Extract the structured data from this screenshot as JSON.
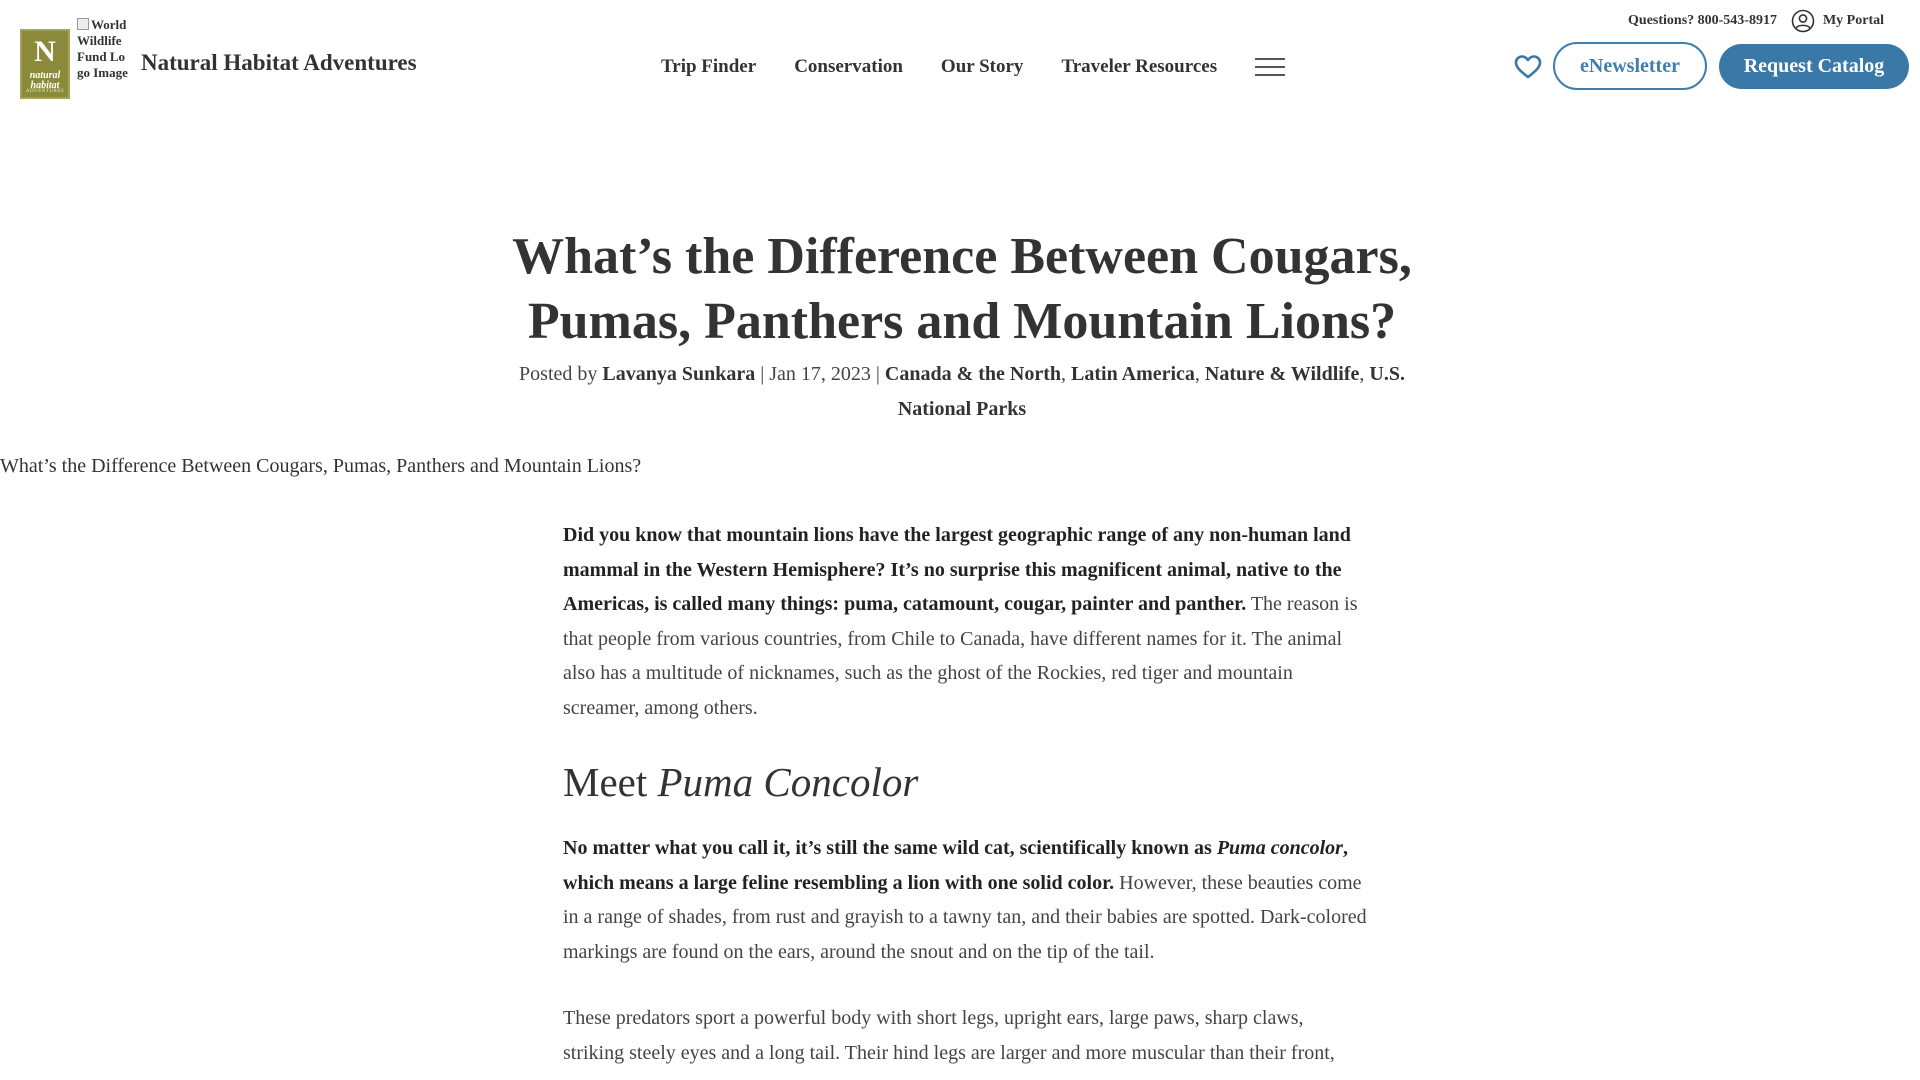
{
  "header": {
    "logo": {
      "letter": "N",
      "word1": "natural",
      "word2": "habitat",
      "word3": "ADVENTURES"
    },
    "wwf_alt": "World Wildlife Fund Logo Image",
    "brand": "Natural Habitat Adventures",
    "nav": [
      "Trip Finder",
      "Conservation",
      "Our Story",
      "Traveler Resources"
    ],
    "phone": "Questions? 800-543-8917",
    "portal": "My Portal",
    "newsletter": "eNewsletter",
    "catalog": "Request Catalog",
    "accent_color": "#3a78a8"
  },
  "article": {
    "title": "What’s the Difference Between Cougars, Pumas, Panthers and Mountain Lions?",
    "posted_by": "Posted by",
    "author": "Lavanya Sunkara",
    "sep": "|",
    "date": "Jan 17, 2023",
    "categories": [
      "Canada & the North",
      "Latin America",
      "Nature & Wildlife",
      "U.S. National Parks"
    ],
    "hero_alt": "What’s the Difference Between Cougars, Pumas, Panthers and Mountain Lions?",
    "p1_bold": "Did you know that mountain lions have the largest geographic range of any non-human land mammal in the Western Hemisphere? It’s no surprise this magnificent animal, native to the Americas, is called many things: puma, catamount, cougar, painter and panther.",
    "p1_rest": " The reason is that people from various countries, from Chile to Canada, have different names for it. The animal also has a multitude of nicknames, such as the ghost of the Rockies, red tiger and mountain screamer, among others.",
    "h2_plain": "Meet ",
    "h2_italic": "Puma Concolor",
    "p2_bold_a": "No matter what you call it, it’s still the same wild cat, scientifically known as ",
    "p2_bold_italic": "Puma concolor",
    "p2_bold_b": ", which means a large feline resembling a lion with one solid color.",
    "p2_rest": " However, these beauties come in a range of shades, from rust and grayish to a tawny tan, and their babies are spotted. Dark-colored markings are found on the ears, around the snout and on the tip of the tail.",
    "p3": "These predators sport a powerful body with short legs, upright ears, large paws, sharp claws, striking steely eyes and a long tail. Their hind legs are larger and more muscular than their front,"
  }
}
